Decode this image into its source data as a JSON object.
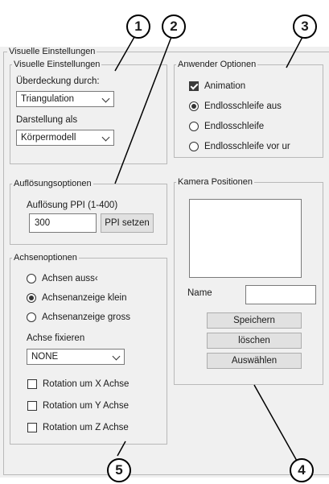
{
  "window": {
    "title": "Visuelle Einstellungen"
  },
  "visual_settings": {
    "legend": "Visuelle Einstellungen",
    "coverage_label": "Überdeckung durch:",
    "coverage_value": "Triangulation",
    "display_label": "Darstellung als",
    "display_value": "Körpermodell"
  },
  "resolution": {
    "legend": "Auflösungsoptionen",
    "ppi_label": "Auflösung PPI (1-400)",
    "ppi_value": "300",
    "set_button": "PPI setzen"
  },
  "axes": {
    "legend": "Achsenoptionen",
    "radios": [
      {
        "label": "Achsen auss‹",
        "selected": false
      },
      {
        "label": "Achsenanzeige klein",
        "selected": true
      },
      {
        "label": "Achsenanzeige gross",
        "selected": false
      }
    ],
    "fix_label": "Achse fixieren",
    "fix_value": "NONE",
    "checks": [
      {
        "label": "Rotation um X Achse",
        "checked": false
      },
      {
        "label": "Rotation um Y Achse",
        "checked": false
      },
      {
        "label": "Rotation um Z Achse",
        "checked": false
      }
    ]
  },
  "user_options": {
    "legend": "Anwender Optionen",
    "animation_label": "Animation",
    "animation_checked": true,
    "radios": [
      {
        "label": "Endlosschleife aus",
        "selected": true
      },
      {
        "label": "Endlosschleife",
        "selected": false
      },
      {
        "label": "Endlosschleife vor ur",
        "selected": false
      }
    ]
  },
  "camera": {
    "legend": "Kamera Positionen",
    "name_label": "Name",
    "name_value": "",
    "save_button": "Speichern",
    "delete_button": "löschen",
    "select_button": "Auswählen"
  },
  "callouts": [
    "1",
    "2",
    "3",
    "4",
    "5"
  ],
  "colors": {
    "panel_bg": "#f0f0f0",
    "border": "#b9b9b9",
    "button_bg": "#e1e1e1"
  }
}
